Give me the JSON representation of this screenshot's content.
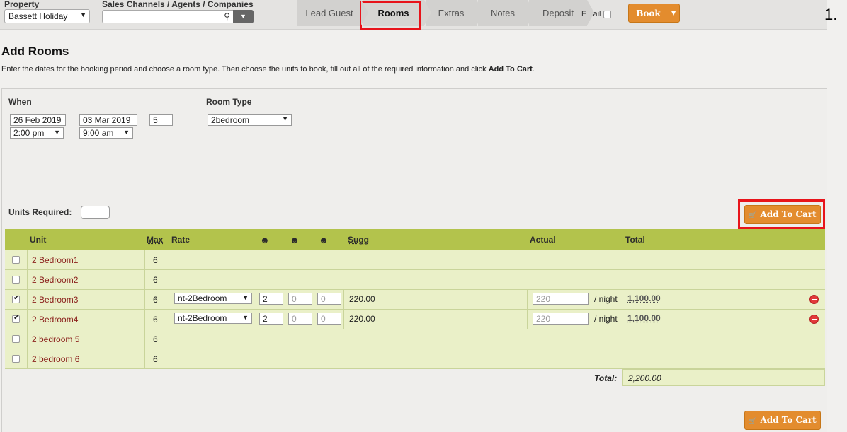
{
  "header": {
    "property_label": "Property",
    "property_value": "Bassett Holiday",
    "channels_label": "Sales Channels / Agents / Companies",
    "steps": [
      {
        "label": "Lead Guest"
      },
      {
        "label": "Rooms"
      },
      {
        "label": "Extras"
      },
      {
        "label": "Notes"
      },
      {
        "label": "Deposit"
      }
    ],
    "email_label": "Email",
    "book_label": "Book",
    "page_number": "1."
  },
  "page": {
    "title": "Add Rooms",
    "instructions_prefix": "Enter the dates for the booking period and choose a room type. Then choose the units to book, fill out all of the required information and click ",
    "instructions_bold": "Add To Cart",
    "instructions_suffix": "."
  },
  "booking": {
    "when_label": "When",
    "arrival_date": "26 Feb 2019",
    "arrival_time": "2:00 pm",
    "departure_date": "03 Mar 2019",
    "departure_time": "9:00 am",
    "nights": "5",
    "room_type_label": "Room Type",
    "room_type": "2bedroom",
    "units_required_label": "Units Required:",
    "units_required_value": "",
    "add_to_cart_label": "Add To Cart"
  },
  "grid": {
    "headers": {
      "unit": "Unit",
      "max": "Max",
      "rate": "Rate",
      "sugg": "Sugg",
      "actual": "Actual",
      "total": "Total"
    },
    "rows": [
      {
        "unit": "2 Bedroom1",
        "max": "6",
        "checked": false
      },
      {
        "unit": "2 Bedroom2",
        "max": "6",
        "checked": false
      },
      {
        "unit": "2 Bedroom3",
        "max": "6",
        "checked": true,
        "rate": "nt-2Bedroom",
        "adults": "2",
        "children": "0",
        "infants": "0",
        "sugg": "220.00",
        "actual": "220",
        "per_night": "/ night",
        "total": "1,100.00"
      },
      {
        "unit": "2 Bedroom4",
        "max": "6",
        "checked": true,
        "rate": "nt-2Bedroom",
        "adults": "2",
        "children": "0",
        "infants": "0",
        "sugg": "220.00",
        "actual": "220",
        "per_night": "/ night",
        "total": "1,100.00"
      },
      {
        "unit": "2 bedroom 5",
        "max": "6",
        "checked": false
      },
      {
        "unit": "2 bedroom 6",
        "max": "6",
        "checked": false
      }
    ],
    "total_label": "Total:",
    "total_value": "2,200.00"
  },
  "colors": {
    "accent_orange": "#e38c2e",
    "grid_header_green": "#b3c34c",
    "row_green": "#eaf0c8",
    "highlight_red": "#e8141b"
  }
}
